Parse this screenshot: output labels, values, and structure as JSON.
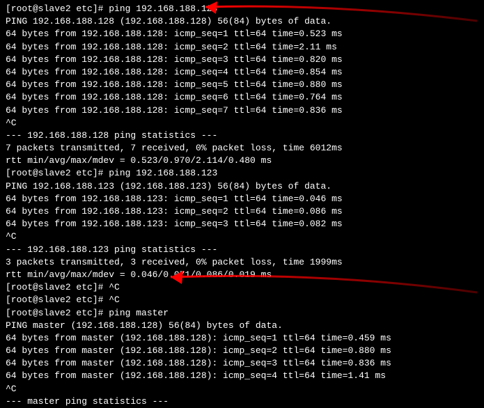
{
  "lines": [
    "[root@slave2 etc]# ping 192.168.188.128",
    "PING 192.168.188.128 (192.168.188.128) 56(84) bytes of data.",
    "64 bytes from 192.168.188.128: icmp_seq=1 ttl=64 time=0.523 ms",
    "64 bytes from 192.168.188.128: icmp_seq=2 ttl=64 time=2.11 ms",
    "64 bytes from 192.168.188.128: icmp_seq=3 ttl=64 time=0.820 ms",
    "64 bytes from 192.168.188.128: icmp_seq=4 ttl=64 time=0.854 ms",
    "64 bytes from 192.168.188.128: icmp_seq=5 ttl=64 time=0.880 ms",
    "64 bytes from 192.168.188.128: icmp_seq=6 ttl=64 time=0.764 ms",
    "64 bytes from 192.168.188.128: icmp_seq=7 ttl=64 time=0.836 ms",
    "^C",
    "--- 192.168.188.128 ping statistics ---",
    "7 packets transmitted, 7 received, 0% packet loss, time 6012ms",
    "rtt min/avg/max/mdev = 0.523/0.970/2.114/0.480 ms",
    "[root@slave2 etc]# ping 192.168.188.123",
    "PING 192.168.188.123 (192.168.188.123) 56(84) bytes of data.",
    "64 bytes from 192.168.188.123: icmp_seq=1 ttl=64 time=0.046 ms",
    "64 bytes from 192.168.188.123: icmp_seq=2 ttl=64 time=0.086 ms",
    "64 bytes from 192.168.188.123: icmp_seq=3 ttl=64 time=0.082 ms",
    "^C",
    "--- 192.168.188.123 ping statistics ---",
    "3 packets transmitted, 3 received, 0% packet loss, time 1999ms",
    "rtt min/avg/max/mdev = 0.046/0.071/0.086/0.019 ms",
    "[root@slave2 etc]# ^C",
    "[root@slave2 etc]# ^C",
    "[root@slave2 etc]# ping master",
    "PING master (192.168.188.128) 56(84) bytes of data.",
    "64 bytes from master (192.168.188.128): icmp_seq=1 ttl=64 time=0.459 ms",
    "64 bytes from master (192.168.188.128): icmp_seq=2 ttl=64 time=0.880 ms",
    "64 bytes from master (192.168.188.128): icmp_seq=3 ttl=64 time=0.836 ms",
    "64 bytes from master (192.168.188.128): icmp_seq=4 ttl=64 time=1.41 ms",
    "^C",
    "--- master ping statistics ---"
  ]
}
